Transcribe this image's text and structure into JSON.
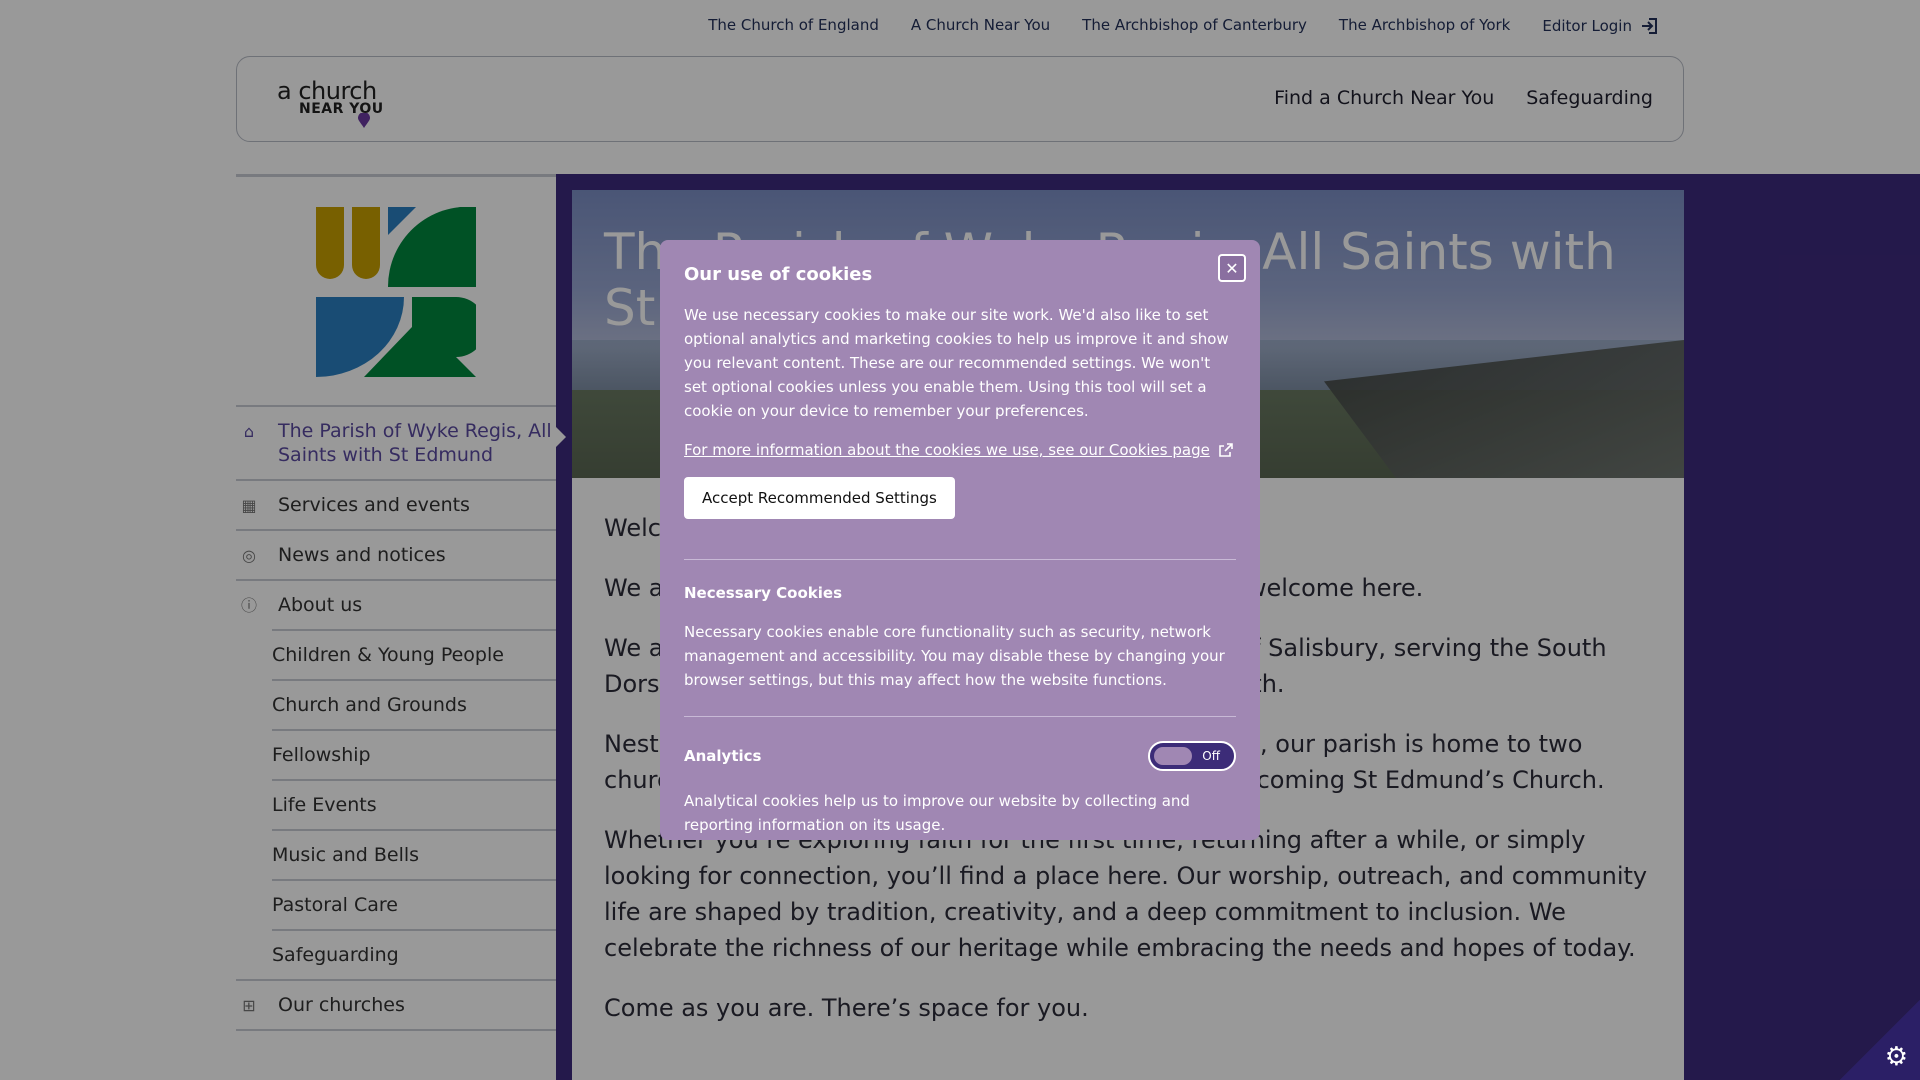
{
  "toplinks": [
    "The Church of England",
    "A Church Near You",
    "The Archbishop of Canterbury",
    "The Archbishop of York"
  ],
  "editor_login": "Editor Login",
  "logo": {
    "line1": "a church",
    "line2": "NEAR YOU"
  },
  "mainnav": {
    "find": "Find a Church Near You",
    "safeguarding": "Safeguarding"
  },
  "sidebar": {
    "items": [
      {
        "label": "The Parish of Wyke Regis, All Saints with St Edmund",
        "icon": "home-icon"
      },
      {
        "label": "Services and events",
        "icon": "calendar-icon"
      },
      {
        "label": "News and notices",
        "icon": "broadcast-icon"
      },
      {
        "label": "About us",
        "icon": "info-icon"
      },
      {
        "label": "Children & Young People"
      },
      {
        "label": "Church and Grounds"
      },
      {
        "label": "Fellowship"
      },
      {
        "label": "Life Events"
      },
      {
        "label": "Music and Bells"
      },
      {
        "label": "Pastoral Care"
      },
      {
        "label": "Safeguarding"
      },
      {
        "label": "Our churches",
        "icon": "church-icon"
      }
    ]
  },
  "hero": {
    "title": "The Parish of Wyke Regis, All Saints with St Edmund"
  },
  "body": {
    "p1": "Welcome to our parish!",
    "p2": "We are an inclusive, welcoming community — all are welcome here.",
    "p3": "We are part of the Church of England in the Diocese of Salisbury, serving the South Dorset parish of Wyke Regis and Lanehouse, Weymouth.",
    "p4": "Nestled on the coast between Weymouth and Portland, our parish is home to two churches: All Saints, consecrated in 1455, and the welcoming St Edmund’s Church.",
    "p5": "Whether you’re exploring faith for the first time, returning after a while, or simply looking for connection, you’ll find a place here. Our worship, outreach, and community life are shaped by tradition, creativity, and a deep commitment to inclusion. We celebrate the richness of our heritage while embracing the needs and hopes of today.",
    "p6": "Come as you are. There’s space for you."
  },
  "cookies": {
    "title": "Our use of cookies",
    "intro": "We use necessary cookies to make our site work. We'd also like to set optional analytics and marketing cookies to help us improve it and show you relevant content. These are our recommended settings. We won't set optional cookies unless you enable them. Using this tool will set a cookie on your device to remember your preferences.",
    "more_link": "For more information about the cookies we use, see our Cookies page",
    "accept": "Accept Recommended Settings",
    "necessary_title": "Necessary Cookies",
    "necessary_text": "Necessary cookies enable core functionality such as security, network management and accessibility. You may disable these by changing your browser settings, but this may affect how the website functions.",
    "analytics_title": "Analytics",
    "analytics_state": "Off",
    "analytics_text": "Analytical cookies help us to improve our website by collecting and reporting information on its usage."
  },
  "colors": {
    "band": "#3d2a7d",
    "modal": "#a087b3",
    "accent": "#5a4aa0"
  }
}
